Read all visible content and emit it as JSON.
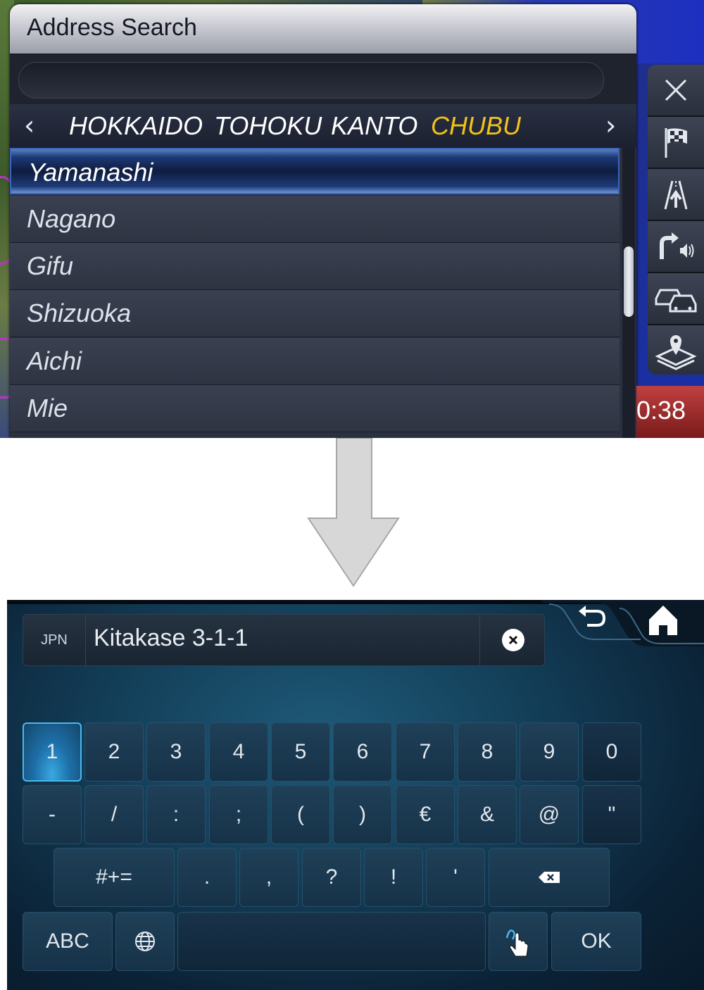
{
  "top_screen": {
    "title": "Address Search",
    "search_value": "",
    "regions": [
      {
        "label": "HOKKAIDO",
        "active": false
      },
      {
        "label": "TOHOKU",
        "active": false
      },
      {
        "label": "KANTO",
        "active": false
      },
      {
        "label": "CHUBU",
        "active": true
      }
    ],
    "prev_icon": "chevron-left-icon",
    "next_icon": "chevron-right-icon",
    "prefectures": [
      "Yamanashi",
      "Nagano",
      "Gifu",
      "Shizuoka",
      "Aichi",
      "Mie"
    ],
    "selected_prefecture": "Yamanashi",
    "side_buttons": [
      "close-icon",
      "checkered-flag-icon",
      "route-icon",
      "turn-voice-icon",
      "traffic-icon",
      "map-layers-icon"
    ],
    "time_fragment": "0:38",
    "accent_color": "#f2c21b"
  },
  "arrow": {
    "icon": "down-arrow-icon"
  },
  "bottom_screen": {
    "language": "JPN",
    "input_value": "Kitakase 3-1-1",
    "clear_icon": "clear-icon",
    "nav_icons": [
      "back-icon",
      "home-icon"
    ],
    "keys": {
      "row1": [
        "1",
        "2",
        "3",
        "4",
        "5",
        "6",
        "7",
        "8",
        "9",
        "0"
      ],
      "row2": [
        "-",
        "/",
        ":",
        ";",
        "(",
        ")",
        "€",
        "&",
        "@",
        "\""
      ],
      "row3_symbols_label": "#+=",
      "row3": [
        ".",
        ",",
        "?",
        "!",
        "'"
      ],
      "backspace_icon": "backspace-icon",
      "abc_label": "ABC",
      "globe_icon": "globe-icon",
      "handwriting_icon": "handwriting-icon",
      "ok_label": "OK"
    },
    "highlighted_key": "1"
  }
}
